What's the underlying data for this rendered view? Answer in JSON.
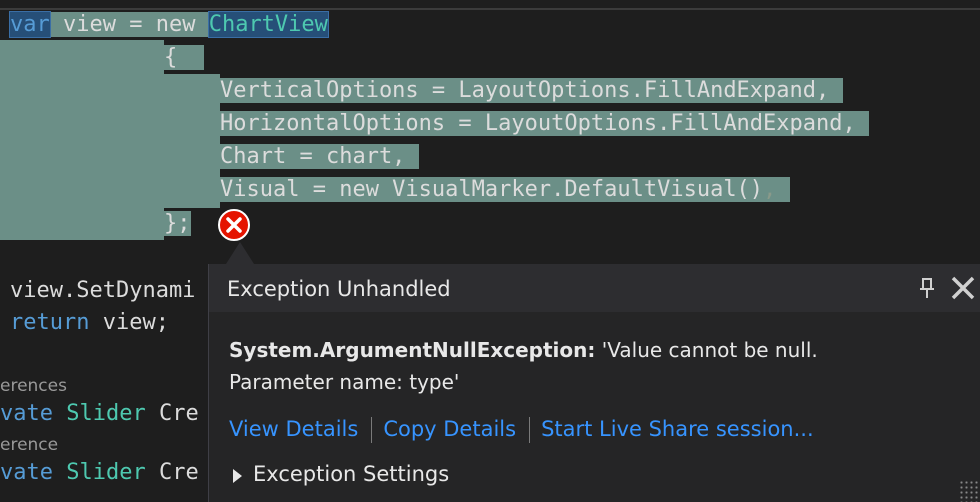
{
  "code": {
    "line1": {
      "kw": "var",
      "middle": " view = new ",
      "type": "ChartView"
    },
    "line2": "{",
    "line3": "VerticalOptions = LayoutOptions.FillAndExpand,",
    "line4": "HorizontalOptions = LayoutOptions.FillAndExpand,",
    "line5": "Chart = chart,",
    "line6": "Visual = new VisualMarker.DefaultVisual()",
    "line6_comma": ",",
    "line7": "};",
    "line8": "view.SetDynami",
    "line9": {
      "kw": "return",
      "rest": " view;"
    },
    "codelens1": "erences",
    "line10": {
      "kw": "vate",
      "type": "Slider",
      "rest": " Cre"
    },
    "codelens2": "erence",
    "line11": {
      "kw": "vate",
      "type": "Slider",
      "rest": " Cre"
    }
  },
  "popup": {
    "title": "Exception Unhandled",
    "exception_type": "System.ArgumentNullException:",
    "exception_message": " 'Value cannot be null.",
    "parameter_line": "Parameter name: type'",
    "link_view_details": "View Details",
    "link_copy_details": "Copy Details",
    "link_live_share": "Start Live Share session...",
    "settings_label": "Exception Settings"
  },
  "icons": {
    "error": "error-x-icon",
    "pin": "pin-icon",
    "close": "close-icon",
    "expand": "expand-triangle-icon",
    "resize": "resize-grip-icon"
  },
  "colors": {
    "editor_bg": "#1e1e1e",
    "selection": "#6b8f87",
    "keyword": "#569cd6",
    "type": "#4ec9b0",
    "link": "#3794ff",
    "error": "#e51400"
  }
}
